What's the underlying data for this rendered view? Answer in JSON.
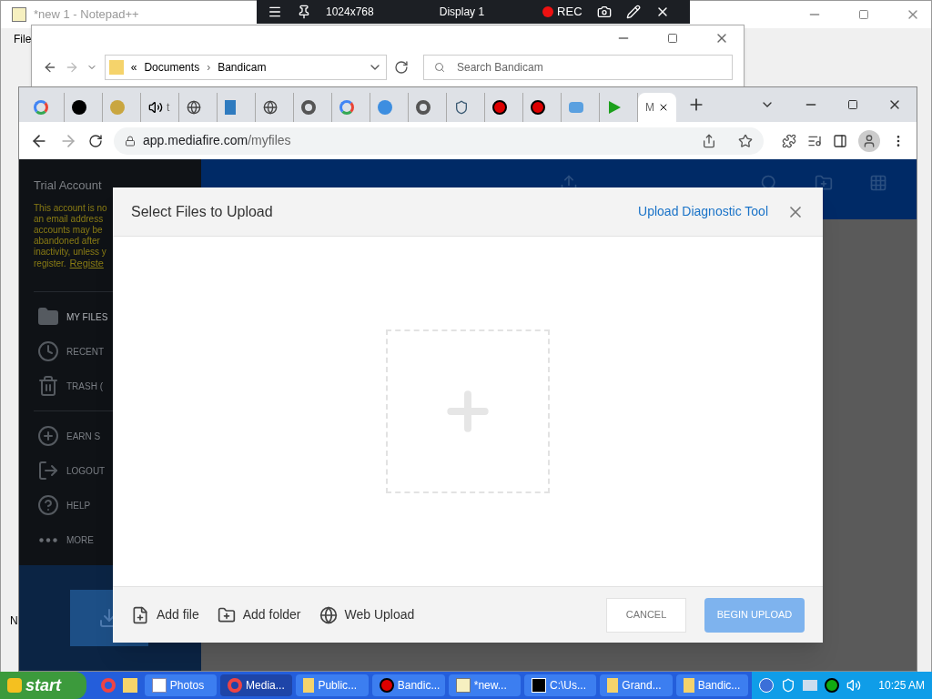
{
  "notepad": {
    "title": "*new 1 - Notepad++",
    "menu": "File",
    "edge_letter": "N"
  },
  "explorer": {
    "overflow": "«",
    "separator": "›",
    "breadcrumb": [
      "Documents",
      "Bandicam"
    ],
    "search": {
      "placeholder": "Search Bandicam"
    }
  },
  "recorder_bar": {
    "resolution": "1024x768",
    "display": "Display 1",
    "rec": "REC"
  },
  "browser": {
    "tabs": [
      {
        "selected": false
      },
      {
        "selected": false
      },
      {
        "selected": false
      },
      {
        "label": "t",
        "selected": false
      },
      {
        "selected": false
      },
      {
        "selected": false
      },
      {
        "selected": false
      },
      {
        "selected": false
      },
      {
        "selected": false
      },
      {
        "selected": false
      },
      {
        "selected": false
      },
      {
        "selected": false
      },
      {
        "selected": false
      },
      {
        "selected": false
      },
      {
        "selected": false
      },
      {
        "selected": false
      },
      {
        "label": "M",
        "selected": true
      }
    ],
    "url_host": "app.mediafire.com",
    "url_path": "/myfiles"
  },
  "sidebar": {
    "account": "Trial Account",
    "notice": [
      "This account is no",
      "an email address",
      "accounts may be",
      "abandoned after",
      "inactivity, unless y",
      "register."
    ],
    "register_link": "Registe",
    "items": [
      {
        "kind": "folder",
        "label": "MY FILES",
        "selected": true
      },
      {
        "kind": "clock",
        "label": "RECENT",
        "selected": false
      },
      {
        "kind": "trash",
        "label": "TRASH (",
        "selected": false
      },
      {
        "kind": "plus",
        "label": "EARN S",
        "selected": false
      },
      {
        "kind": "logout",
        "label": "LOGOUT",
        "selected": false
      },
      {
        "kind": "help",
        "label": "HELP",
        "selected": false
      },
      {
        "kind": "more",
        "label": "MORE",
        "selected": false
      }
    ]
  },
  "dialog": {
    "title": "Select Files to Upload",
    "diagnostic_link": "Upload Diagnostic Tool",
    "sources": [
      {
        "kind": "file",
        "label": "Add file"
      },
      {
        "kind": "folder",
        "label": "Add folder"
      },
      {
        "kind": "web",
        "label": "Web Upload"
      }
    ],
    "cancel": "CANCEL",
    "begin": {
      "label": "BEGIN UPLOAD",
      "disabled": true
    }
  },
  "taskbar": {
    "start": "start",
    "items": [
      {
        "kind": "photos",
        "label": "Photos",
        "selected": false
      },
      {
        "kind": "chrome",
        "label": "Media...",
        "selected": true
      },
      {
        "kind": "folder",
        "label": "Public...",
        "selected": false
      },
      {
        "kind": "rec",
        "label": "Bandic...",
        "selected": false
      },
      {
        "kind": "notepad",
        "label": "*new...",
        "selected": false
      },
      {
        "kind": "zip",
        "label": "C:\\Us...",
        "selected": false
      },
      {
        "kind": "folder",
        "label": "Grand...",
        "selected": false
      },
      {
        "kind": "folder",
        "label": "Bandic...",
        "selected": false
      }
    ],
    "clock": "10:25 AM"
  }
}
